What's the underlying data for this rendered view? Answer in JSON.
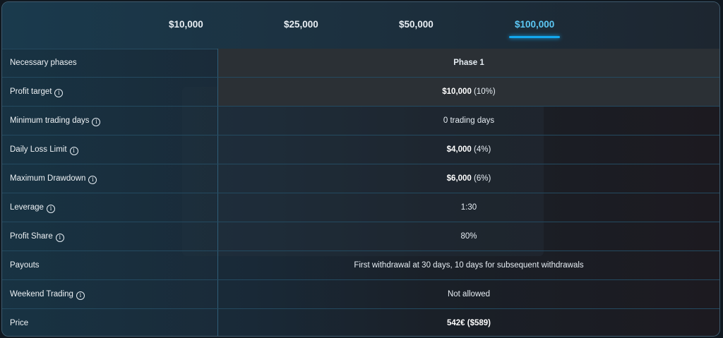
{
  "tabs": [
    {
      "label": "$10,000"
    },
    {
      "label": "$25,000"
    },
    {
      "label": "$50,000"
    },
    {
      "label": "$100,000",
      "active": true
    }
  ],
  "rows": [
    {
      "label": "Necessary phases",
      "value": "Phase 1",
      "info": false
    },
    {
      "label": "Profit target",
      "value_bold": "$10,000",
      "value_rest": " (10%)",
      "info": true
    },
    {
      "label": "Minimum trading days",
      "value": "0 trading days",
      "info": true
    },
    {
      "label": "Daily Loss Limit",
      "value_bold": "$4,000",
      "value_rest": " (4%)",
      "info": true
    },
    {
      "label": "Maximum Drawdown",
      "value_bold": "$6,000",
      "value_rest": " (6%)",
      "info": true
    },
    {
      "label": "Leverage",
      "value": "1:30",
      "info": true
    },
    {
      "label": "Profit Share",
      "value": "80%",
      "info": true
    },
    {
      "label": "Payouts",
      "value": "First withdrawal at 30 days, 10 days for subsequent withdrawals",
      "info": false
    },
    {
      "label": "Weekend Trading",
      "value": "Not allowed",
      "info": true
    },
    {
      "label": "Price",
      "value_bold": "542€ ($589)",
      "value_rest": "",
      "info": false
    }
  ],
  "colors": {
    "accent": "#13a8ef",
    "phase": "#1da6e6"
  },
  "icons": {
    "info": "info-circle-icon"
  }
}
